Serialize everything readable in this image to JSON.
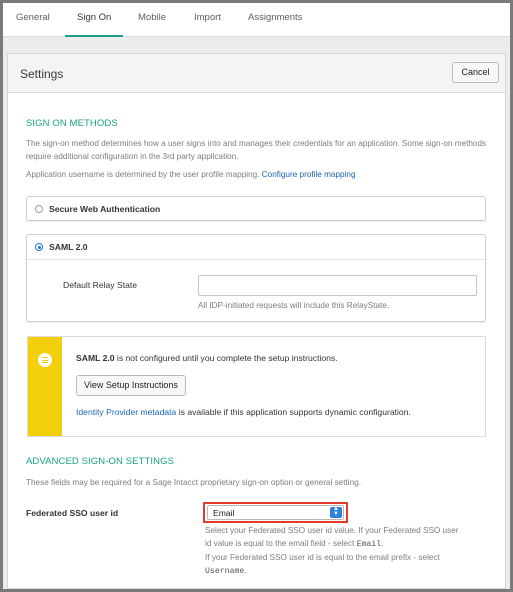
{
  "tabs": [
    {
      "label": "General",
      "active": false
    },
    {
      "label": "Sign On",
      "active": true
    },
    {
      "label": "Mobile",
      "active": false
    },
    {
      "label": "Import",
      "active": false
    },
    {
      "label": "Assignments",
      "active": false
    }
  ],
  "settings": {
    "title": "Settings",
    "cancel_label": "Cancel"
  },
  "sign_on_methods": {
    "heading": "SIGN ON METHODS",
    "description": "The sign-on method determines how a user signs into and manages their credentials for an application. Some sign-on methods require additional configuration in the 3rd party application.",
    "username_text": "Application username is determined by the user profile mapping.",
    "profile_link": "Configure profile mapping",
    "option_swa": "Secure Web Authentication",
    "option_saml": "SAML 2.0",
    "selected": "SAML 2.0",
    "relay_state_label": "Default Relay State",
    "relay_state_value": "",
    "relay_state_help": "All IDP-initiated requests will include this RelayState."
  },
  "notice": {
    "strong": "SAML 2.0",
    "text": "is not configured until you complete the setup instructions.",
    "button_label": "View Setup Instructions",
    "metadata_link": "Identity Provider metadata",
    "metadata_text": "is available if this application supports dynamic configuration.",
    "icon": "list-icon",
    "color": "#f2cf0a"
  },
  "advanced": {
    "heading": "ADVANCED SIGN-ON SETTINGS",
    "description": "These fields may be required for a Sage Intacct proprietary sign-on option or general setting.",
    "federated_label": "Federated SSO user id",
    "federated_value": "Email",
    "help_line1": "Select your Federated SSO user id value. If your Federated SSO user",
    "help_line2_pre": "id value is equal to the email field - select",
    "help_line2_code": "Email",
    "help_line2_post": ".",
    "help_line3": "If your Federated SSO user id is equal to the email prefix - select",
    "help_line4_code": "Username",
    "help_line4_post": "."
  },
  "colors": {
    "accent": "#1aa08c",
    "link": "#1766b8",
    "highlight": "#e23b2e"
  }
}
